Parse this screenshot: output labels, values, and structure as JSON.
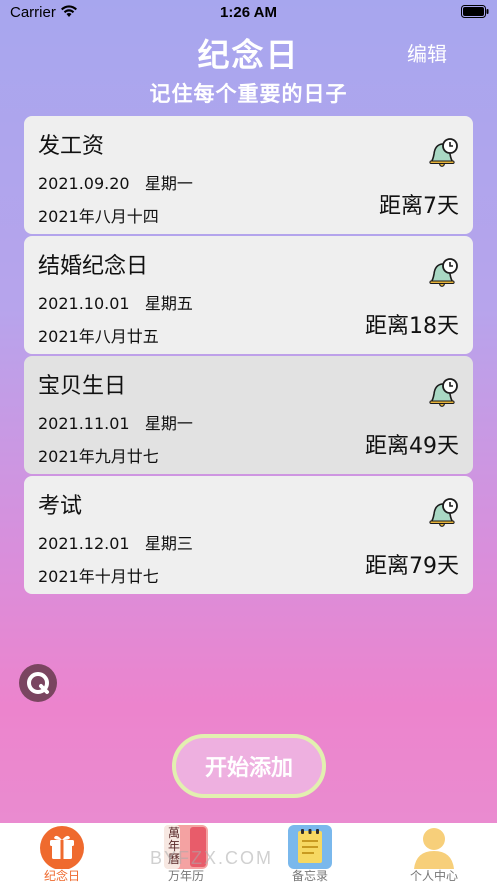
{
  "status_bar": {
    "carrier": "Carrier",
    "time": "1:26 AM"
  },
  "header": {
    "title": "纪念日",
    "edit_label": "编辑",
    "subtitle": "记住每个重要的日子"
  },
  "events": [
    {
      "name": "发工资",
      "date": "2021.09.20",
      "weekday": "星期一",
      "lunar": "2021年八月十四",
      "distance": "距离7天"
    },
    {
      "name": "结婚纪念日",
      "date": "2021.10.01",
      "weekday": "星期五",
      "lunar": "2021年八月廿五",
      "distance": "距离18天"
    },
    {
      "name": "宝贝生日",
      "date": "2021.11.01",
      "weekday": "星期一",
      "lunar": "2021年九月廿七",
      "distance": "距离49天"
    },
    {
      "name": "考试",
      "date": "2021.12.01",
      "weekday": "星期三",
      "lunar": "2021年十月廿七",
      "distance": "距离79天"
    }
  ],
  "add_button_label": "开始添加",
  "tabs": [
    {
      "label": "纪念日",
      "icon": "gift-icon",
      "active": true
    },
    {
      "label": "万年历",
      "icon": "calendar-icon",
      "active": false
    },
    {
      "label": "备忘录",
      "icon": "notepad-icon",
      "active": false
    },
    {
      "label": "个人中心",
      "icon": "user-icon",
      "active": false
    }
  ],
  "calendar_icon_text": "萬年曆",
  "watermark": "BYFZX.COM",
  "colors": {
    "accent": "#ef6a2e",
    "add_button": "#eeb0e0",
    "add_button_border": "#e2f0b0"
  }
}
